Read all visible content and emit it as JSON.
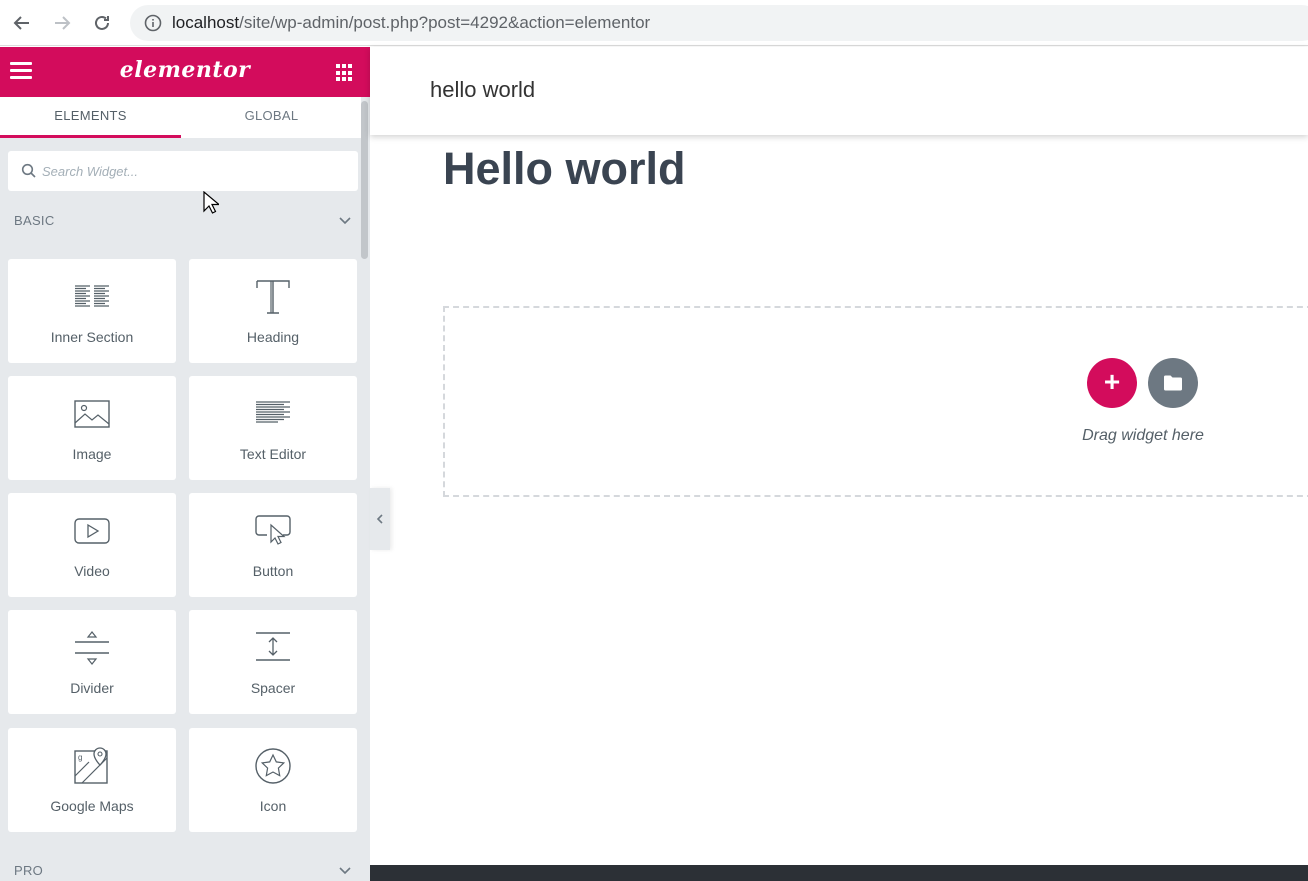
{
  "browser": {
    "url_host": "localhost",
    "url_path": "/site/wp-admin/post.php?post=4292&action=elementor"
  },
  "panel": {
    "logo": "elementor",
    "tabs": [
      {
        "label": "ELEMENTS",
        "active": true
      },
      {
        "label": "GLOBAL",
        "active": false
      }
    ],
    "search_placeholder": "Search Widget...",
    "categories": {
      "basic": "BASIC",
      "pro": "PRO"
    },
    "widgets": [
      {
        "label": "Inner Section",
        "icon": "inner-section-icon"
      },
      {
        "label": "Heading",
        "icon": "heading-icon"
      },
      {
        "label": "Image",
        "icon": "image-icon"
      },
      {
        "label": "Text Editor",
        "icon": "text-editor-icon"
      },
      {
        "label": "Video",
        "icon": "video-icon"
      },
      {
        "label": "Button",
        "icon": "button-icon"
      },
      {
        "label": "Divider",
        "icon": "divider-icon"
      },
      {
        "label": "Spacer",
        "icon": "spacer-icon"
      },
      {
        "label": "Google Maps",
        "icon": "google-maps-icon"
      },
      {
        "label": "Icon",
        "icon": "star-icon"
      }
    ]
  },
  "preview": {
    "site_title": "hello world",
    "page_title": "Hello world",
    "add_button": "+",
    "drag_text": "Drag widget here"
  },
  "colors": {
    "brand": "#d30c5c",
    "panel_bg": "#e6e9ec",
    "template_button": "#6d7882"
  }
}
